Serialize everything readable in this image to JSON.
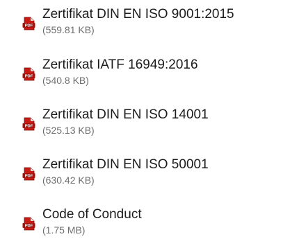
{
  "files": [
    {
      "name": "Zertifikat DIN EN ISO 9001:2015",
      "size": "(559.81 KB)",
      "icon": "pdf-icon"
    },
    {
      "name": "Zertifikat IATF 16949:2016",
      "size": "(540.8 KB)",
      "icon": "pdf-icon"
    },
    {
      "name": "Zertifikat DIN EN ISO 14001",
      "size": "(525.13 KB)",
      "icon": "pdf-icon"
    },
    {
      "name": "Zertifikat DIN EN ISO 50001",
      "size": "(630.42 KB)",
      "icon": "pdf-icon"
    },
    {
      "name": "Code of Conduct",
      "size": "(1.75 MB)",
      "icon": "pdf-icon"
    }
  ],
  "colors": {
    "link_text": "#1b1b1b",
    "size_text": "#6e6e6e",
    "pdf_red": "#c91a13"
  }
}
